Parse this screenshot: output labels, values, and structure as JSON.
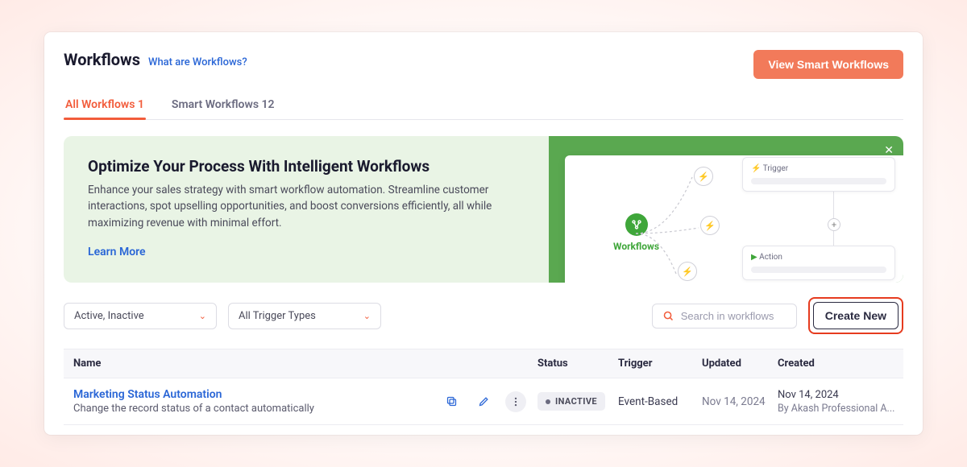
{
  "header": {
    "title": "Workflows",
    "help_link": "What are Workflows?",
    "view_smart_btn": "View Smart Workflows"
  },
  "tabs": [
    {
      "label": "All Workflows 1",
      "active": true
    },
    {
      "label": "Smart Workflows 12",
      "active": false
    }
  ],
  "banner": {
    "title": "Optimize Your Process With Intelligent Workflows",
    "desc": "Enhance your sales strategy with smart workflow automation. Streamline customer interactions, spot upselling opportunities, and boost conversions efficiently, all while maximizing revenue with minimal effort.",
    "learn_more": "Learn More",
    "art_label": "Workflows",
    "card_trigger": "Trigger",
    "card_action": "Action"
  },
  "controls": {
    "status_filter": "Active, Inactive",
    "trigger_filter": "All Trigger Types",
    "search_placeholder": "Search in workflows",
    "create_btn": "Create New"
  },
  "table": {
    "headers": {
      "name": "Name",
      "status": "Status",
      "trigger": "Trigger",
      "updated": "Updated",
      "created": "Created"
    },
    "rows": [
      {
        "name": "Marketing Status Automation",
        "desc": "Change the record status of a contact automatically",
        "status": "INACTIVE",
        "trigger": "Event-Based",
        "updated": "Nov 14, 2024",
        "created_date": "Nov 14, 2024",
        "created_by": "By Akash Professional A..."
      }
    ]
  }
}
